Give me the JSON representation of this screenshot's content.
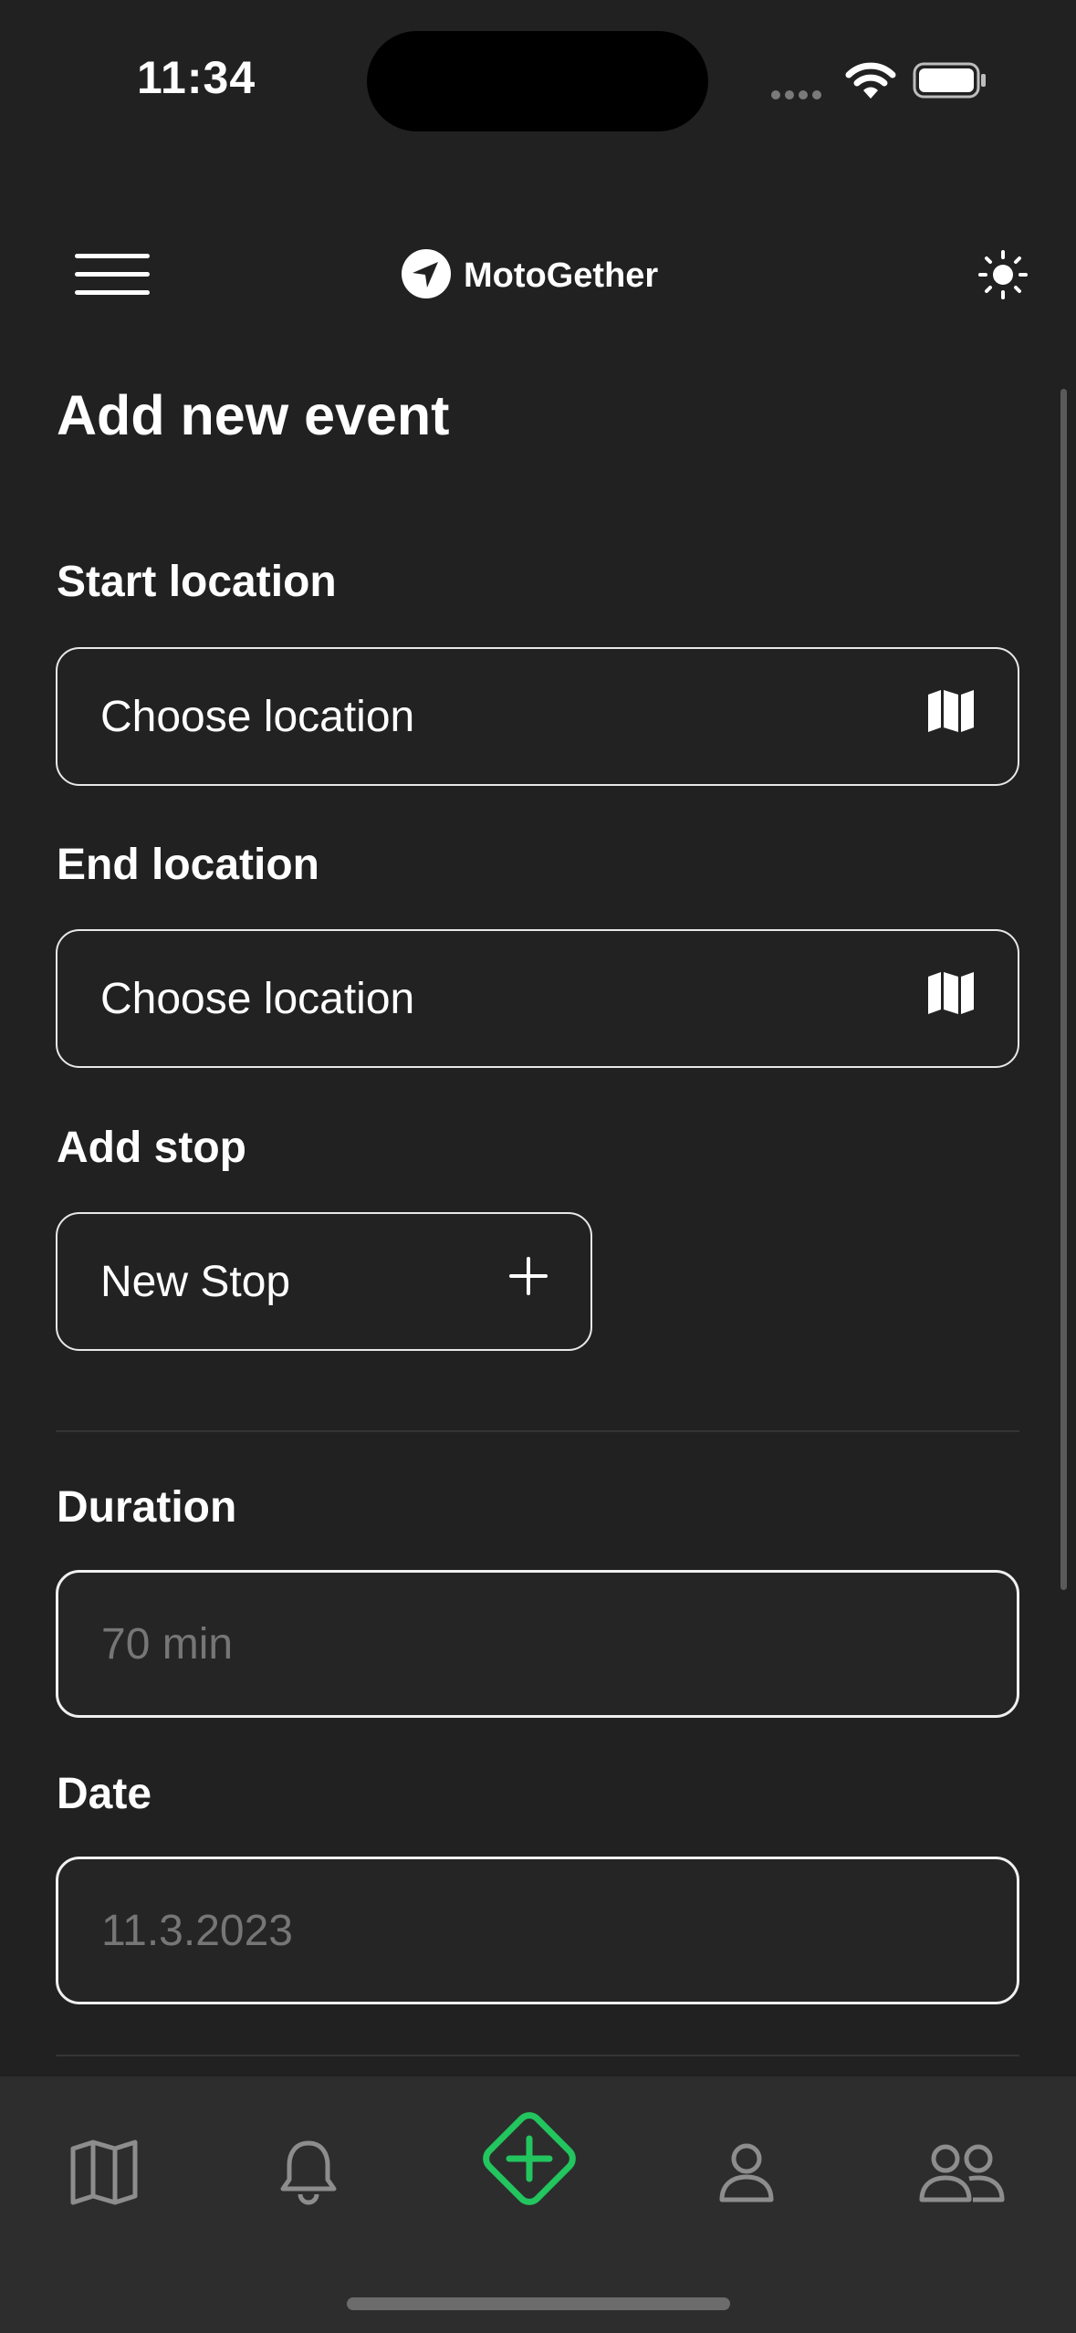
{
  "status_bar": {
    "time": "11:34"
  },
  "header": {
    "app_name": "MotoGether"
  },
  "page": {
    "title": "Add new event"
  },
  "form": {
    "start_location": {
      "label": "Start location",
      "value": "Choose location"
    },
    "end_location": {
      "label": "End location",
      "value": "Choose location"
    },
    "add_stop": {
      "label": "Add stop",
      "button_label": "New Stop"
    },
    "duration": {
      "label": "Duration",
      "placeholder": "70 min"
    },
    "date": {
      "label": "Date",
      "placeholder": "11.3.2023"
    }
  },
  "tab_bar": {
    "tabs": [
      "map-icon",
      "bell-icon",
      "add-event-icon",
      "profile-icon",
      "group-icon"
    ],
    "active_color": "#22c55e"
  },
  "colors": {
    "background": "#212121",
    "tab_bar": "#2d2d2d",
    "accent": "#22c55e"
  }
}
